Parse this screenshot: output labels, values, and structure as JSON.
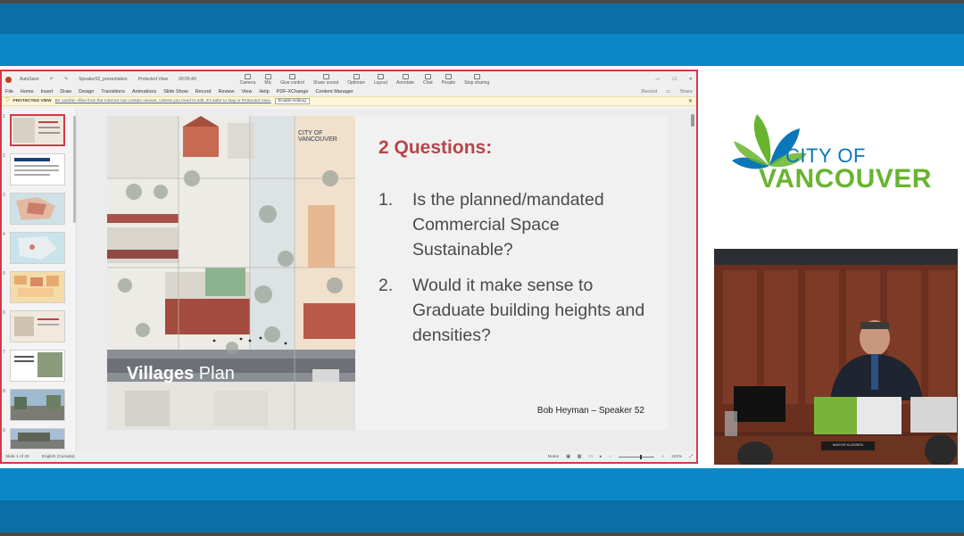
{
  "powerpoint": {
    "title_bar": {
      "autosave": "AutoSave",
      "filename": "Speaker52_presentation",
      "status": "Protected View",
      "timer": "00:55:40",
      "tools": [
        "Camera",
        "Mic",
        "Give control",
        "Share sound",
        "Optimize",
        "Layout",
        "Annotate",
        "Chat",
        "People",
        "Stop sharing"
      ],
      "people_count": "11"
    },
    "menu": [
      "File",
      "Home",
      "Insert",
      "Draw",
      "Design",
      "Transitions",
      "Animations",
      "Slide Show",
      "Record",
      "Review",
      "View",
      "Help",
      "PDF-XChange",
      "Content Manager"
    ],
    "menu_right": [
      "Record",
      "Share"
    ],
    "protected_view": {
      "label": "PROTECTED VIEW",
      "message": "Be careful—files from the Internet can contain viruses. Unless you need to edit, it's safer to stay in Protected View.",
      "button": "Enable Editing"
    },
    "thumbnails": [
      "1",
      "2",
      "3",
      "4",
      "5",
      "6",
      "7",
      "8",
      "9"
    ],
    "slide": {
      "image_logo": "CITY OF VANCOUVER",
      "image_caption_bold": "Villages",
      "image_caption": "Plan",
      "title": "2 Questions:",
      "questions": [
        {
          "num": "1.",
          "text": "Is the planned/mandated Commercial Space Sustainable?"
        },
        {
          "num": "2.",
          "text": "Would it make sense to Graduate building heights and densities?"
        }
      ],
      "speaker": "Bob Heyman – Speaker 52"
    },
    "status_bar": {
      "slide": "Slide 1 of 25",
      "language": "English (Canada)",
      "notes": "Notes",
      "zoom": "122%"
    }
  },
  "city_logo": {
    "line1": "CITY OF",
    "line2": "VANCOUVER"
  },
  "video": {
    "nameplate": "MAYOR KLASSEN"
  }
}
